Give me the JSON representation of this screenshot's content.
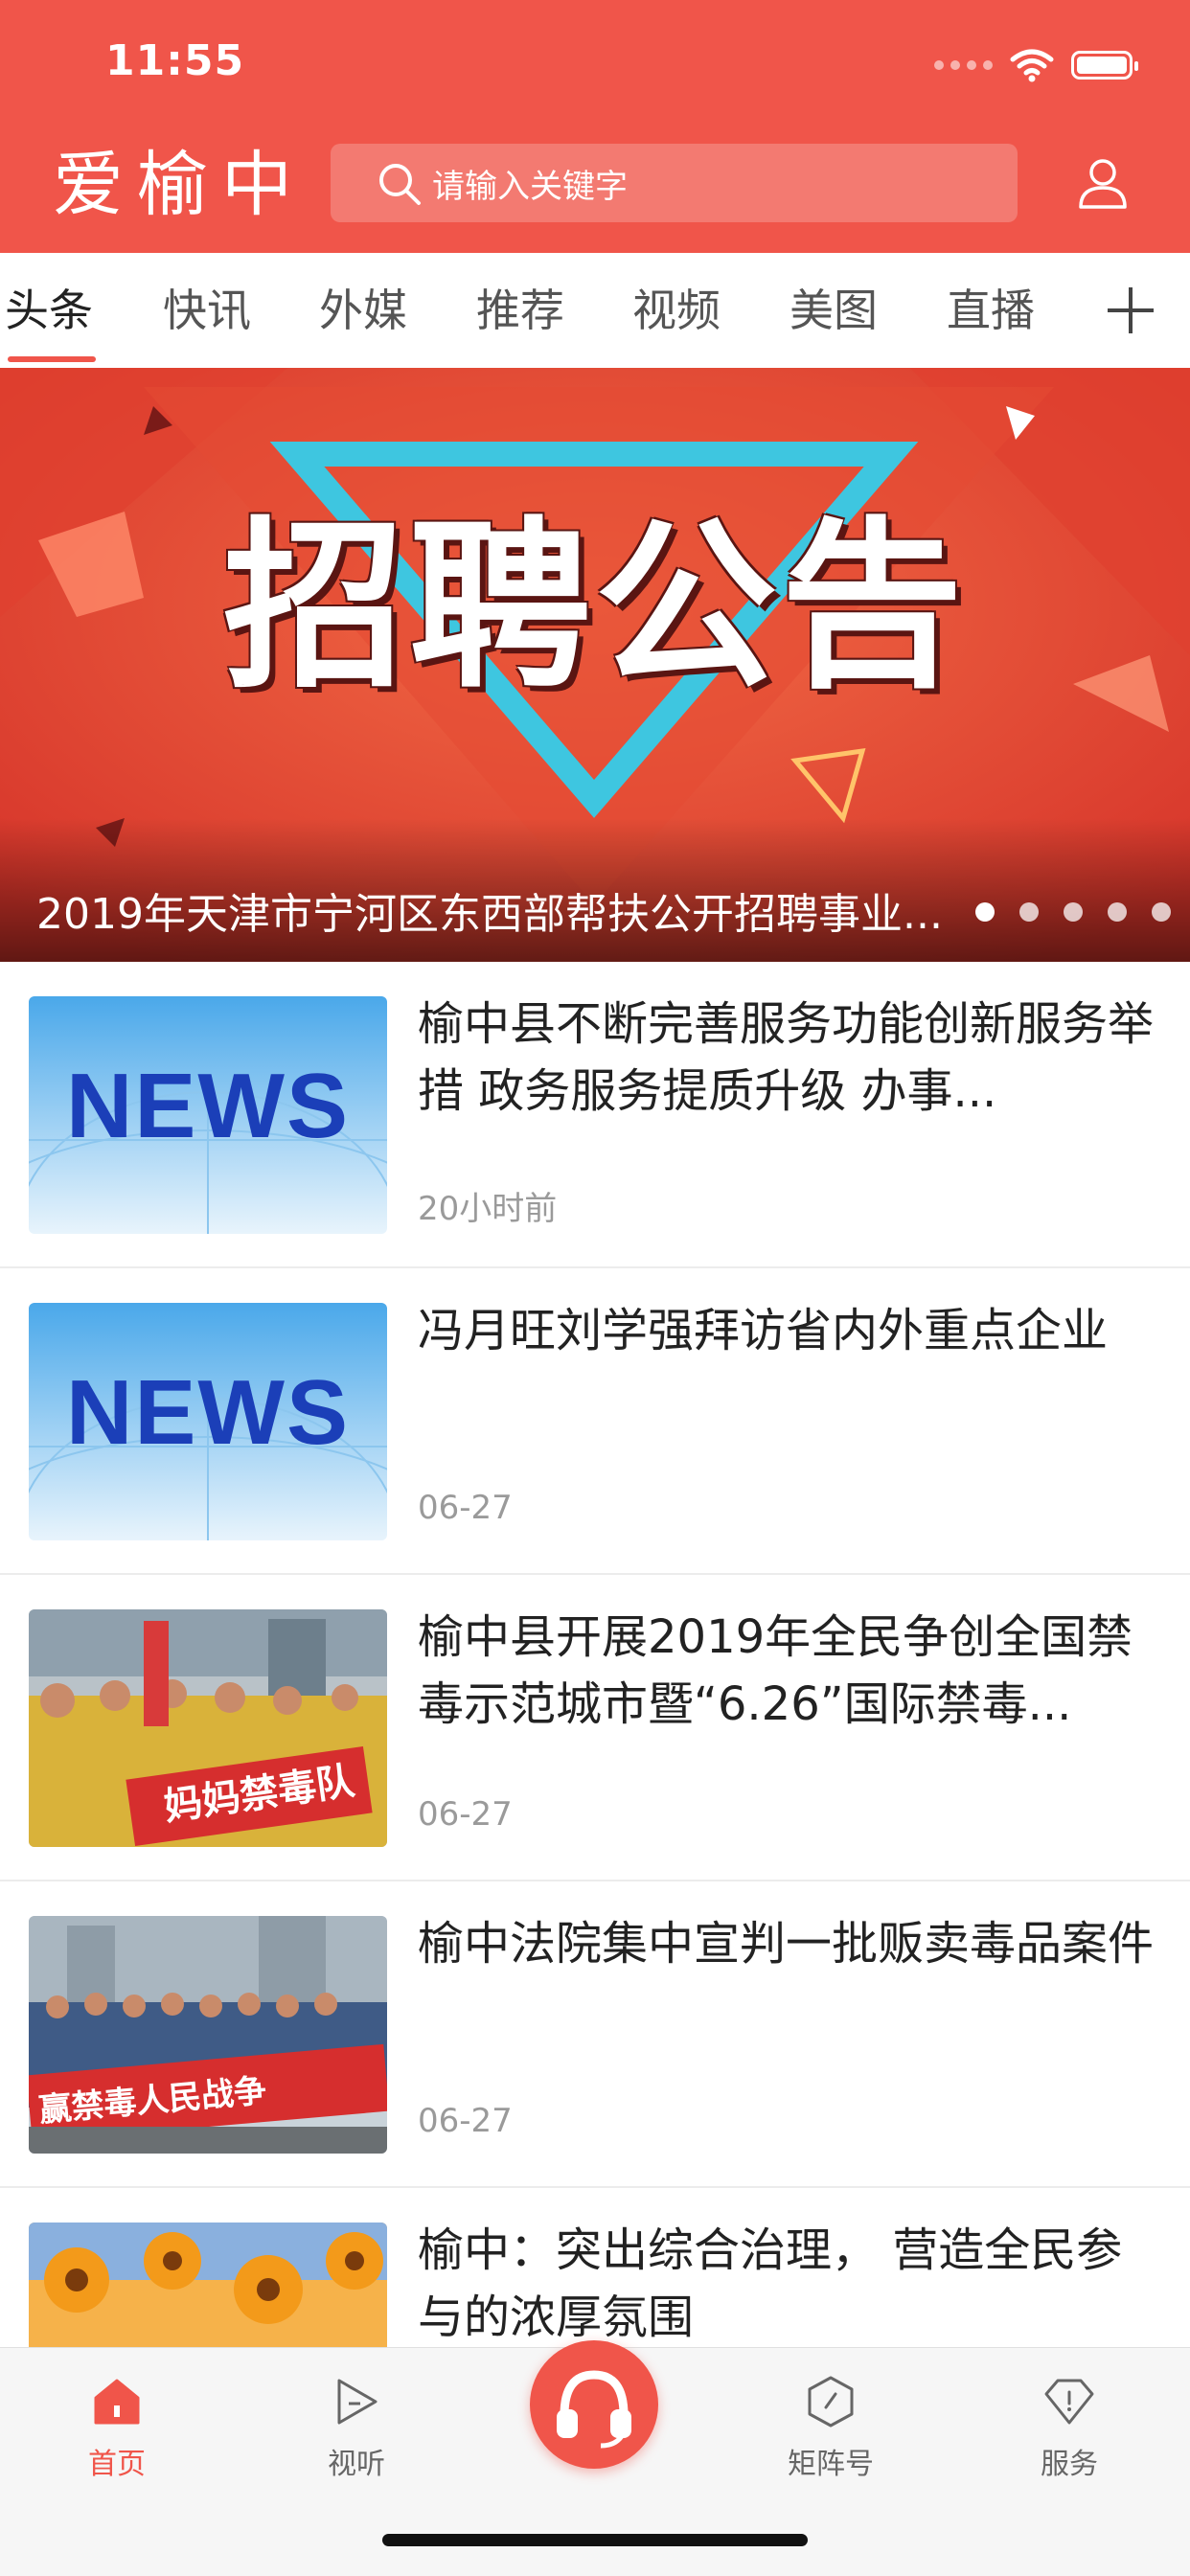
{
  "status_bar": {
    "time": "11:55"
  },
  "header": {
    "logo": "爱榆中",
    "search_placeholder": "请输入关键字"
  },
  "tabs": [
    {
      "label": "头条",
      "active": true
    },
    {
      "label": "快讯"
    },
    {
      "label": "外媒"
    },
    {
      "label": "推荐"
    },
    {
      "label": "视频"
    },
    {
      "label": "美图"
    },
    {
      "label": "直播"
    }
  ],
  "banner": {
    "image_text": "招聘公告",
    "title": "2019年天津市宁河区东西部帮扶公开招聘事业...",
    "dots_count": 5,
    "active_dot": 0
  },
  "news": [
    {
      "title": "榆中县不断完善服务功能创新服务举措 政务服务提质升级 办事...",
      "time": "20小时前",
      "thumb": "news-banner",
      "thumb_text": "NEWS"
    },
    {
      "title": "冯月旺刘学强拜访省内外重点企业",
      "time": "06-27",
      "thumb": "news-banner",
      "thumb_text": "NEWS"
    },
    {
      "title": "榆中县开展2019年全民争创全国禁毒示范城市暨“6.26”国际禁毒...",
      "time": "06-27",
      "thumb": "photo-rally",
      "thumb_text": "妈妈禁毒队"
    },
    {
      "title": "榆中法院集中宣判一批贩卖毒品案件",
      "time": "06-27",
      "thumb": "photo-police",
      "thumb_text": "赢禁毒人民战争"
    },
    {
      "title": "榆中：突出综合治理， 营造全民参与的浓厚氛围",
      "time": "",
      "thumb": "photo-flowers",
      "thumb_text": ""
    }
  ],
  "bottom_nav": [
    {
      "label": "首页",
      "icon": "home-icon",
      "active": true
    },
    {
      "label": "视听",
      "icon": "play-icon"
    },
    {
      "label": "",
      "icon": "headset-icon"
    },
    {
      "label": "矩阵号",
      "icon": "compass-icon"
    },
    {
      "label": "服务",
      "icon": "service-icon"
    }
  ],
  "colors": {
    "brand": "#f0554a",
    "text": "#222222",
    "muted": "#9a9a9a"
  }
}
